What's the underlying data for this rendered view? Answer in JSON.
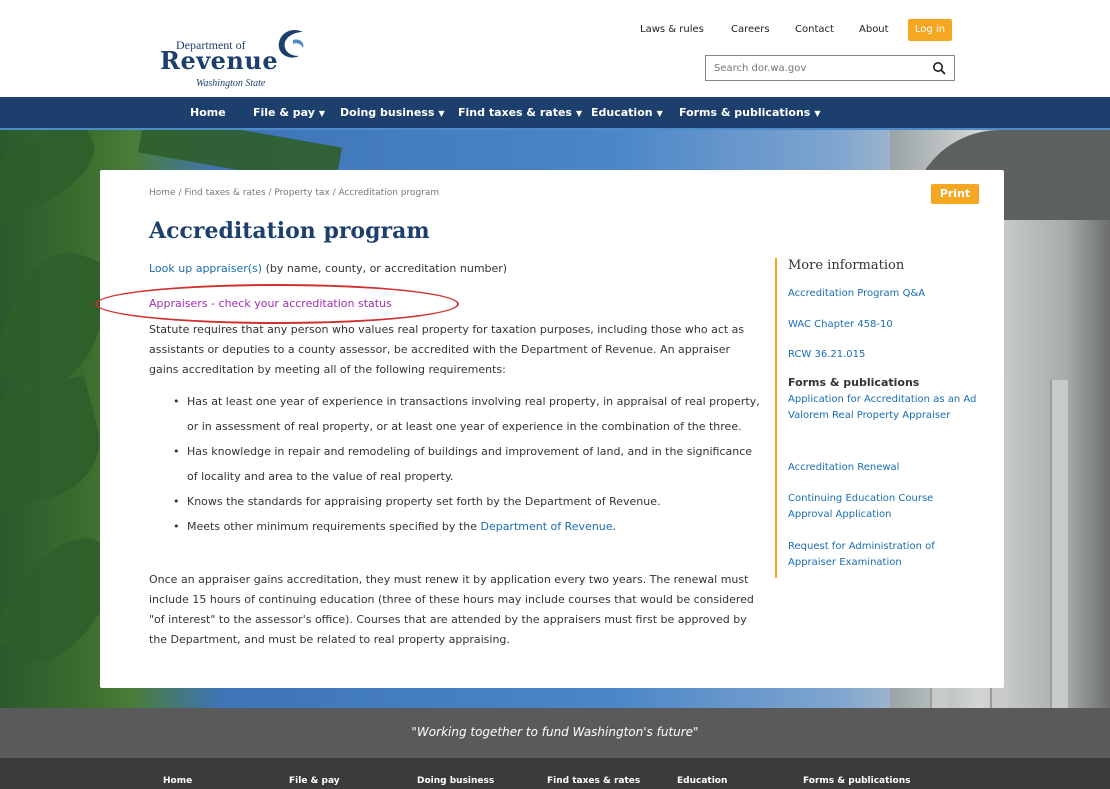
{
  "header": {
    "logo": {
      "line1": "Department of",
      "line2": "Revenue",
      "line3": "Washington State"
    },
    "top_links": [
      "Laws & rules",
      "Careers",
      "Contact",
      "About"
    ],
    "login_label": "Log in",
    "search_placeholder": "Search dor.wa.gov"
  },
  "nav": {
    "items": [
      {
        "label": "Home",
        "has_dropdown": false
      },
      {
        "label": "File & pay",
        "has_dropdown": true
      },
      {
        "label": "Doing business",
        "has_dropdown": true
      },
      {
        "label": "Find taxes & rates",
        "has_dropdown": true
      },
      {
        "label": "Education",
        "has_dropdown": true
      },
      {
        "label": "Forms & publications",
        "has_dropdown": true
      }
    ],
    "caret": "▼"
  },
  "content": {
    "breadcrumb": "Home / Find taxes & rates / Property tax / Accreditation program",
    "print_label": "Print",
    "title": "Accreditation program",
    "lookup_link": "Look up appraiser(s)",
    "lookup_text": " (by name, county, or accreditation number)",
    "appraisers_link": "Appraisers - check your accreditation status",
    "intro": "Statute requires that any person who values real property for taxation purposes, including those who act as assistants or deputies to a county assessor, be accredited with the Department of Revenue. An appraiser gains accreditation by meeting all of the following requirements:",
    "requirements": [
      "Has at least one year of experience in transactions involving real property, in appraisal of real property, or in assessment of real property, or at least one year of experience in the combination of the three.",
      "Has knowledge in repair and remodeling of buildings and improvement of land, and in the significance of locality and area to the value of real property.",
      "Knows the standards for appraising property set forth by the Department of Revenue."
    ],
    "req4_prefix": "Meets other minimum requirements specified by the ",
    "req4_link": "Department of Revenue",
    "req4_suffix": ".",
    "renewal": "Once an appraiser gains accreditation, they must renew it by application every two years. The renewal must include 15 hours of continuing education (three of these hours may include courses that would be considered \"of interest\" to the assessor's office). Courses that are attended by the appraisers must first be approved by the Department, and must be related to real property appraising."
  },
  "sidebar": {
    "title": "More information",
    "links": [
      "Accreditation Program Q&A",
      "WAC Chapter 458-10",
      "RCW 36.21.015"
    ],
    "forms_heading": "Forms & publications",
    "forms_links": [
      "Application for Accreditation as an Ad Valorem Real Property Appraiser",
      "Accreditation Renewal",
      "Continuing Education Course Approval Application",
      "Request for Administration of Appraiser Examination"
    ]
  },
  "footer": {
    "tagline": "\"Working together to fund Washington's future\"",
    "links": [
      "Home",
      "File & pay",
      "Doing business",
      "Find taxes & rates",
      "Education",
      "Forms & publications"
    ]
  },
  "colors": {
    "brand_navy": "#1d3f6e",
    "accent_orange": "#f5a623",
    "link_blue": "#1a6db3",
    "visited_purple": "#a030b0",
    "annotation_red": "#d03030"
  }
}
